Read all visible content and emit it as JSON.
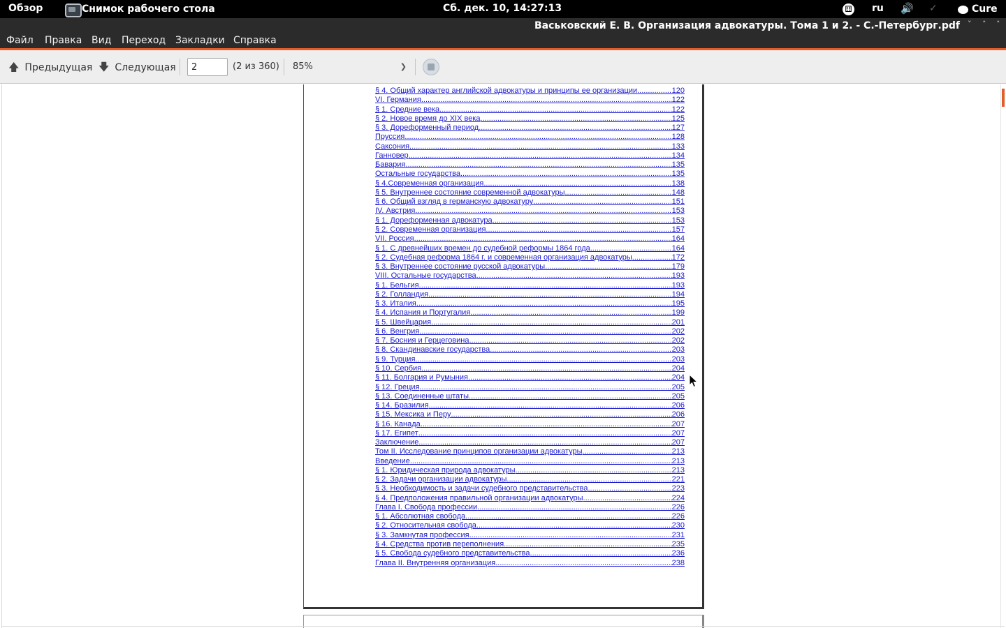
{
  "top_panel": {
    "overview": "Обзор",
    "app_name": "Снимок рабочего стола",
    "clock": "Сб. дек. 10, 14:27:13",
    "lang": "ru",
    "user": "Cure",
    "icons": {
      "app": "screenshot-app-icon",
      "accessibility": "accessibility-icon",
      "volume": "volume-icon",
      "network": "network-icon",
      "user": "chat-bubble-icon"
    }
  },
  "window": {
    "title": "Васьковский Е. В. Организация адвокатуры. Тома 1 и 2. - С.-Петербург.pdf",
    "buttons": {
      "menu": "˅",
      "maximize": "˄",
      "close": "˄"
    }
  },
  "menubar": {
    "items": [
      "Файл",
      "Правка",
      "Вид",
      "Переход",
      "Закладки",
      "Справка"
    ]
  },
  "toolbar": {
    "prev_label": "Предыдущая",
    "next_label": "Следующая",
    "page_value": "2",
    "page_count": "(2 из 360)",
    "zoom": "85%",
    "icons": {
      "prev": "arrow-up-icon",
      "next": "arrow-down-icon",
      "zoom": "chevron-down-icon",
      "fullscreen": "fullscreen-icon"
    }
  },
  "colors": {
    "accent": "#e55c2b",
    "link": "#1a1ad0",
    "panel": "#000000",
    "chrome": "#2b2b2b",
    "toolbar": "#eeeeee"
  },
  "toc": [
    {
      "title": "§ 4. Общий характер английской адвокатуры и принципы ее организации",
      "page": "120"
    },
    {
      "title": "VI. Германия",
      "page": "122"
    },
    {
      "title": "§ 1. Средние века",
      "page": "122"
    },
    {
      "title": "§ 2. Новое время до XIX века",
      "page": "125"
    },
    {
      "title": "§ 3. Дореформенный период",
      "page": "127"
    },
    {
      "title": "Пруссия",
      "page": "128"
    },
    {
      "title": "Саксония",
      "page": "133"
    },
    {
      "title": "Ганновер",
      "page": "134"
    },
    {
      "title": "Бавария",
      "page": "135"
    },
    {
      "title": "Остальные государства",
      "page": "135"
    },
    {
      "title": "§ 4.Современная организация",
      "page": "138"
    },
    {
      "title": "§ 5. Внутреннее состояние современной адвокатуры",
      "page": "148"
    },
    {
      "title": "§ 6. Общий взгляд в германскую адвокатуру",
      "page": "151"
    },
    {
      "title": "IV. Австрия",
      "page": "153"
    },
    {
      "title": "§ 1. Дореформенная адвокатура",
      "page": "153"
    },
    {
      "title": "§ 2. Современная организация",
      "page": "157"
    },
    {
      "title": "VII. Россия",
      "page": "164"
    },
    {
      "title": "§ 1. С древнейших времен до судебной реформы 1864 года",
      "page": "164"
    },
    {
      "title": "§ 2. Судебная реформа 1864 г. и современная организация адвокатуры",
      "page": "172"
    },
    {
      "title": "§ 3. Внутреннее состояние русской адвокатуры",
      "page": "179"
    },
    {
      "title": "VIII. Остальные государства",
      "page": "193"
    },
    {
      "title": "§ 1. Бельгия",
      "page": "193"
    },
    {
      "title": "§ 2. Голландия",
      "page": "194"
    },
    {
      "title": "§ 3. Италия",
      "page": "195"
    },
    {
      "title": "§ 4. Испания и Португалия",
      "page": "199"
    },
    {
      "title": "§ 5. Швейцария",
      "page": "201"
    },
    {
      "title": "§ 6. Венгрия",
      "page": "202"
    },
    {
      "title": "§ 7. Босния и Герцеговина",
      "page": "202"
    },
    {
      "title": "§ 8. Скандинавские государства",
      "page": "203"
    },
    {
      "title": "§ 9. Турция",
      "page": "203"
    },
    {
      "title": "§ 10. Сербия",
      "page": "204"
    },
    {
      "title": "§ 11. Болгария и Румыния",
      "page": "204"
    },
    {
      "title": "§ 12. Греция",
      "page": "205"
    },
    {
      "title": "§ 13. Соединенные штаты",
      "page": "205"
    },
    {
      "title": "§ 14. Бразилия",
      "page": "206"
    },
    {
      "title": "§ 15. Мексика и Перу",
      "page": "206"
    },
    {
      "title": "§ 16. Канада",
      "page": "207"
    },
    {
      "title": "§ 17. Египет",
      "page": "207"
    },
    {
      "title": "Заключение",
      "page": "207"
    },
    {
      "title": "Том II. Исследование принципов организации адвокатуры",
      "page": "213"
    },
    {
      "title": "Введение",
      "page": "213"
    },
    {
      "title": "§ 1. Юридическая природа адвокатуры",
      "page": "213"
    },
    {
      "title": "§ 2. Задачи организации адвокатуры",
      "page": "221"
    },
    {
      "title": "§ 3. Необходимость и задачи судебного представительства",
      "page": "223"
    },
    {
      "title": "§ 4. Предположения правильной организации адвокатуры",
      "page": "224"
    },
    {
      "title": "Глава I. Свобода профессии",
      "page": "226"
    },
    {
      "title": "§ 1. Абсолютная свобода",
      "page": "226"
    },
    {
      "title": "§ 2. Относительная свобода",
      "page": "230"
    },
    {
      "title": "§ 3. Замкнутая профессия",
      "page": "231"
    },
    {
      "title": "§ 4. Средства против переполнения",
      "page": "235"
    },
    {
      "title": "§ 5. Свобода судебного представительства",
      "page": "236"
    },
    {
      "title": "Глава II. Внутренняя организация",
      "page": "238"
    }
  ]
}
